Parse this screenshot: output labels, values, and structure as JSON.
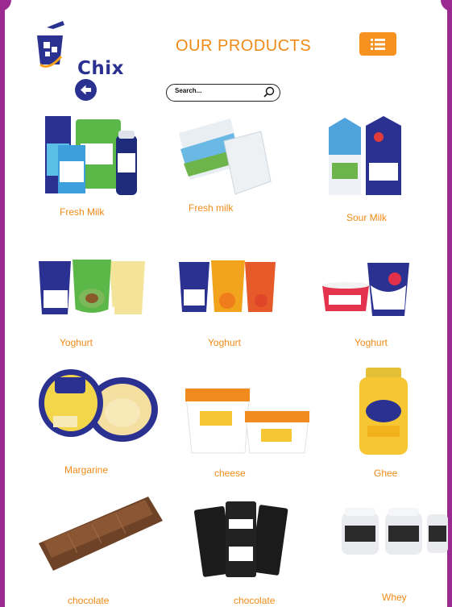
{
  "header": {
    "brand": "Chix",
    "title": "OUR PRODUCTS",
    "menu_icon": "list-icon",
    "back_icon": "arrow-left-icon"
  },
  "search": {
    "placeholder": "Search...",
    "icon": "search-icon"
  },
  "colors": {
    "accent_orange": "#ef8a17",
    "brand_navy": "#2a3190",
    "frame_purple": "#9a2a8f"
  },
  "products": [
    {
      "name": "Fresh Milk"
    },
    {
      "name": "Fresh milk"
    },
    {
      "name": "Sour Milk"
    },
    {
      "name": "Yoghurt"
    },
    {
      "name": "Yoghurt"
    },
    {
      "name": "Yoghurt"
    },
    {
      "name": "Margarine"
    },
    {
      "name": "cheese"
    },
    {
      "name": "Ghee"
    },
    {
      "name": "chocolate"
    },
    {
      "name": "chocolate"
    },
    {
      "name": "Whey"
    }
  ]
}
